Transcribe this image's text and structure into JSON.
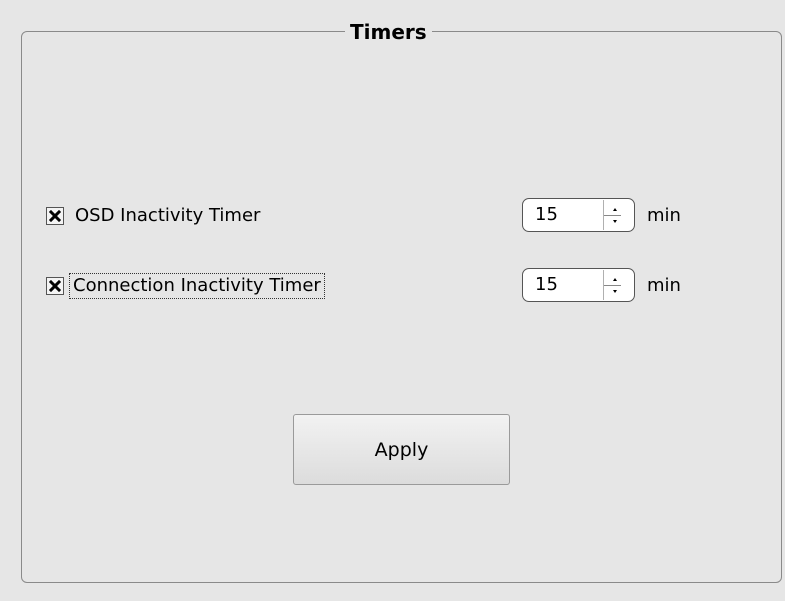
{
  "group": {
    "title": "Timers"
  },
  "timers": [
    {
      "label": "OSD Inactivity Timer",
      "checked": true,
      "value": "15",
      "unit": "min"
    },
    {
      "label": "Connection Inactivity Timer",
      "checked": true,
      "value": "15",
      "unit": "min"
    }
  ],
  "actions": {
    "apply_label": "Apply"
  },
  "colors": {
    "panel_background": "#e6e6e6",
    "border": "#8a8a8a"
  }
}
